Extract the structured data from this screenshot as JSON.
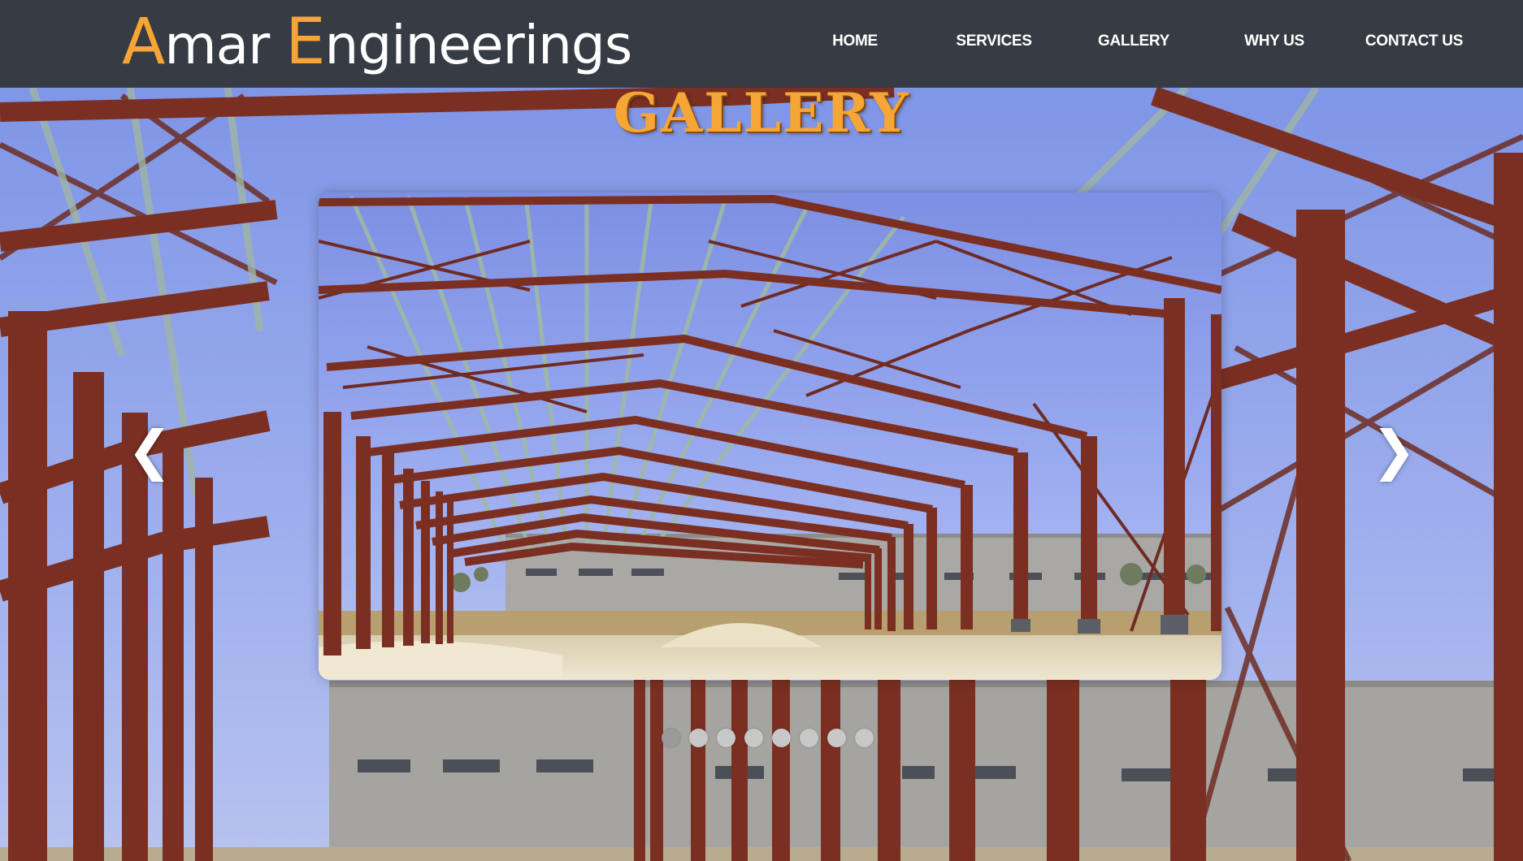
{
  "brand": {
    "initial1": "A",
    "rest1": "mar ",
    "initial2": "E",
    "rest2": "ngineerings"
  },
  "nav": {
    "home": "HOME",
    "services": "SERVICES",
    "gallery": "GALLERY",
    "why_us": "WHY US",
    "contact_us": "CONTACT US"
  },
  "section": {
    "title": "GALLERY"
  },
  "carousel": {
    "prev_symbol": "❮",
    "next_symbol": "❯",
    "slide_count": 8,
    "active_slide": 1
  },
  "colors": {
    "header_bg": "#363b44",
    "brand_accent": "#f7a534",
    "steel": "#7a2f22",
    "sky": "#8fa3e8"
  }
}
